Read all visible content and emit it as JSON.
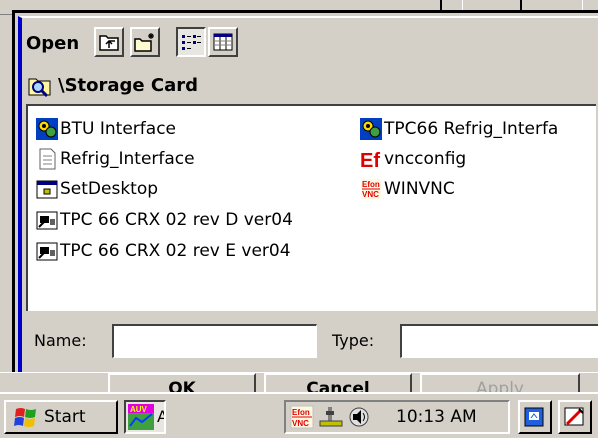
{
  "dialog": {
    "title": "Open",
    "current_path": "\\Storage Card",
    "toolbar": {
      "up_icon": "up-folder-icon",
      "new_folder_icon": "new-folder-icon",
      "list_view_icon": "list-view-icon",
      "details_view_icon": "details-view-icon"
    },
    "files": [
      {
        "name": "BTU Interface",
        "icon": "app-gears-icon"
      },
      {
        "name": "Refrig_Interface",
        "icon": "document-icon"
      },
      {
        "name": "SetDesktop",
        "icon": "app-window-icon"
      },
      {
        "name": "TPC 66 CRX 02 rev D ver04",
        "icon": "shortcut-icon"
      },
      {
        "name": "TPC 66 CRX 02 rev E ver04",
        "icon": "shortcut-icon"
      },
      {
        "name": "TPC66 Refrig_Interfa",
        "icon": "app-gears-icon"
      },
      {
        "name": "vncconfig",
        "icon": "efon-icon"
      },
      {
        "name": "WINVNC",
        "icon": "efon-vnc-icon"
      }
    ],
    "name_label": "Name:",
    "name_value": "",
    "type_label": "Type:",
    "type_value": "",
    "buttons": {
      "ok": "OK",
      "cancel": "Cancel",
      "apply": "Apply"
    }
  },
  "taskbar": {
    "start_label": "Start",
    "task_label": "A",
    "clock": "10:13 AM",
    "tray_icons": [
      "efon-vnc-icon",
      "network-icon",
      "speaker-icon"
    ],
    "desktop_icon": "desktop-icon",
    "input_panel_icon": "input-panel-icon"
  },
  "colors": {
    "face": "#d4d0c8",
    "highlight": "#ffffff",
    "shadow": "#404040",
    "accent_border": "#0000c8",
    "efon_red": "#e00000"
  }
}
